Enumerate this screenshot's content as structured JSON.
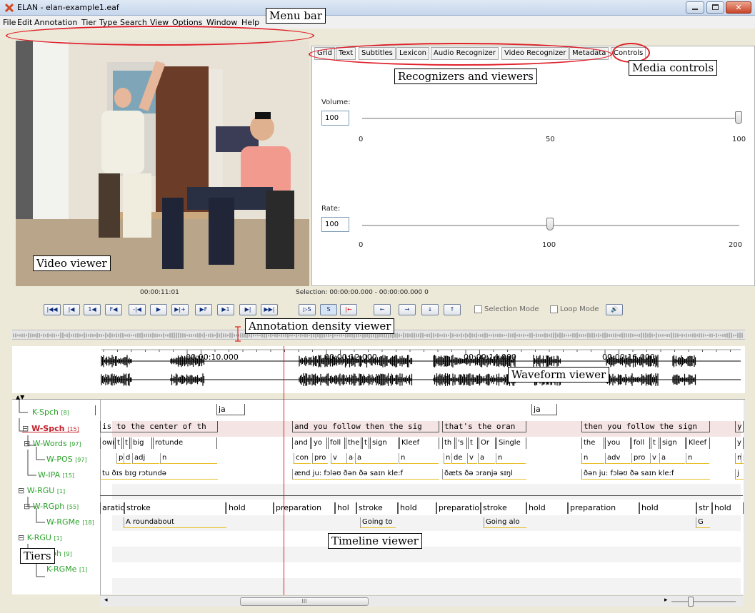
{
  "window": {
    "title": "ELAN - elan-example1.eaf"
  },
  "menu": [
    "File",
    "Edit",
    "Annotation",
    "Tier",
    "Type",
    "Search",
    "View",
    "Options",
    "Window",
    "Help"
  ],
  "tabs": [
    "Grid",
    "Text",
    "Subtitles",
    "Lexicon",
    "Audio Recognizer",
    "Video Recognizer",
    "Metadata",
    "Controls"
  ],
  "controls": {
    "volume_label": "Volume:",
    "volume_value": "100",
    "volume_ticks": [
      "0",
      "50",
      "100"
    ],
    "volume_level": 100,
    "rate_label": "Rate:",
    "rate_value": "100",
    "rate_ticks": [
      "0",
      "100",
      "200"
    ],
    "rate_level": 100
  },
  "player": {
    "current_time": "00:00:11:01",
    "selection": "Selection: 00:00:00.000 - 00:00:00.000 0",
    "selection_mode": "Selection Mode",
    "loop_mode": "Loop Mode",
    "buttons": [
      "|◀◀",
      "|◀",
      "1◀",
      "F◀",
      "-|◀",
      "▶",
      "▶|+",
      "▶F",
      "▶1",
      "▶|",
      "▶▶|"
    ],
    "sel_buttons": [
      "▷S",
      "S",
      "|←"
    ],
    "nav_buttons": [
      "←",
      "→",
      "↓",
      "↑"
    ]
  },
  "timeline": {
    "ticks": [
      "00:00:10.000",
      "00:00:12.000",
      "00:00:14.000",
      "00:00:16.000"
    ]
  },
  "tiers": [
    {
      "name": "K-Spch",
      "count": "[8]",
      "indent": 0
    },
    {
      "name": "W-Spch",
      "count": "[15]",
      "indent": 0,
      "active": true
    },
    {
      "name": "W-Words",
      "count": "[97]",
      "indent": 1
    },
    {
      "name": "W-POS",
      "count": "[97]",
      "indent": 2
    },
    {
      "name": "W-IPA",
      "count": "[15]",
      "indent": 1
    },
    {
      "name": "W-RGU",
      "count": "[1]",
      "indent": 0
    },
    {
      "name": "W-RGph",
      "count": "[55]",
      "indent": 1
    },
    {
      "name": "W-RGMe",
      "count": "[18]",
      "indent": 2
    },
    {
      "name": "K-RGU",
      "count": "[1]",
      "indent": 0
    },
    {
      "name": "K-RGph",
      "count": "[9]",
      "indent": 1
    },
    {
      "name": "K-RGMe",
      "count": "[1]",
      "indent": 2
    }
  ],
  "annotations": {
    "kspch": [
      "ja",
      "ja"
    ],
    "wspch": [
      "is to the center of th",
      "and you follow then the sig",
      "that's the oran",
      "then you follow the sign",
      "y"
    ],
    "wwords": [
      "own",
      "t",
      "t",
      "big",
      "rotunde",
      "and",
      "yo",
      "foll",
      "the",
      "t",
      "sign",
      "Kleef",
      "th",
      "'s",
      "t",
      "Or",
      "Single",
      "the",
      "you",
      "foll",
      "t",
      "sign",
      "Kleef",
      "y"
    ],
    "wpos": [
      "p",
      "d",
      "adj",
      "n",
      "con",
      "pro",
      "v",
      "adv",
      "a",
      "n",
      "n",
      "de",
      "v",
      "a",
      "n",
      "n",
      "adv",
      "pro",
      "v",
      "a",
      "n",
      "n",
      "p"
    ],
    "wipa": [
      "tu ðɪs bɪg rɔtundə",
      "ænd ju: fɔləʊ ðən ðə saɪn kle:f",
      "ðæts ðə ɔranjə sɪŋl",
      "ðən ju: fɔləʊ ðə saɪn kle:f",
      "j"
    ],
    "wrgph": [
      "aratio",
      "stroke",
      "hold",
      "preparation",
      "hol",
      "stroke",
      "hold",
      "preparatio",
      "stroke",
      "hold",
      "preparation",
      "hold",
      "str",
      "hold"
    ],
    "wrgme": [
      "A roundabout",
      "Going to",
      "Going alo",
      "G"
    ]
  },
  "scrollbar": {
    "grip": "III"
  },
  "callouts": {
    "menu_bar": "Menu bar",
    "recognizers": "Recognizers and viewers",
    "media_controls": "Media controls",
    "video_viewer": "Video viewer",
    "density": "Annotation density viewer",
    "waveform": "Waveform viewer",
    "timeline": "Timeline viewer",
    "tiers": "Tiers"
  }
}
